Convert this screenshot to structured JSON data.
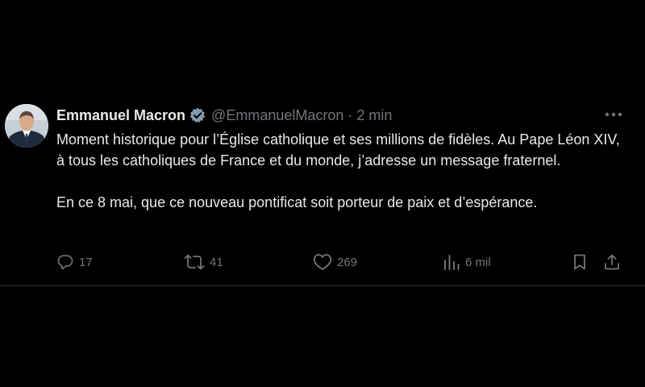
{
  "tweet": {
    "author_name": "Emmanuel Macron",
    "handle": "@EmmanuelMacron",
    "separator": "·",
    "time": "2 min",
    "paragraphs": [
      "Moment historique pour l’Église catholique et ses millions de fidèles. Au Pape Léon XIV, à tous les catholiques de France et du monde, j’adresse un message fraternel.",
      "En ce 8 mai, que ce nouveau pontificat soit porteur de paix et d’espérance."
    ],
    "verified": true
  },
  "actions": {
    "replies": "17",
    "retweets": "41",
    "likes": "269",
    "views": "6 mil"
  },
  "icons": {
    "verified": "verified-badge-icon",
    "more": "more-options-icon",
    "reply": "reply-icon",
    "retweet": "retweet-icon",
    "like": "heart-icon",
    "views": "views-chart-icon",
    "bookmark": "bookmark-icon",
    "share": "share-icon"
  },
  "colors": {
    "background": "#000000",
    "primary_text": "#e7e9ea",
    "secondary_text": "#71767b",
    "verified_badge": "#829aab",
    "divider": "#2f3336"
  }
}
